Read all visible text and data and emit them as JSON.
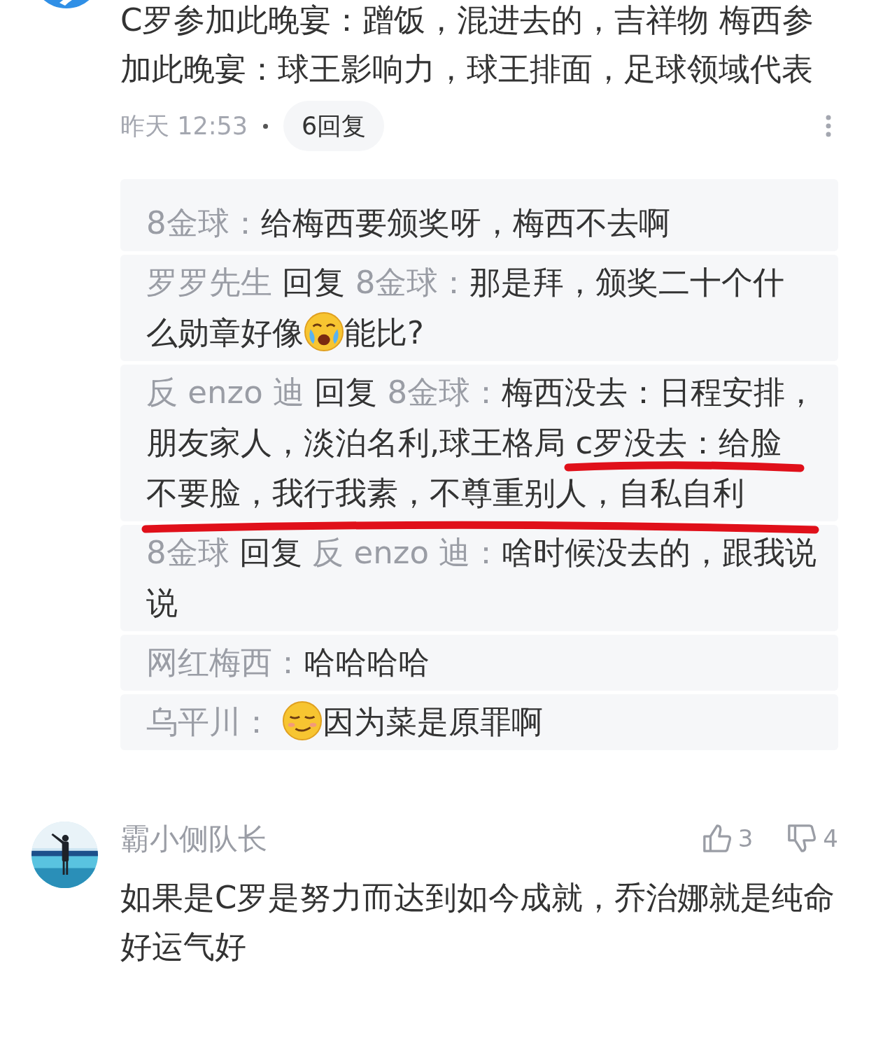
{
  "comments": [
    {
      "avatar": {
        "kind": "picture"
      },
      "text": "C罗参加此晚宴：蹭饭，混进去的，吉祥物 梅西参加此晚宴：球王影响力，球王排面，足球领域代表",
      "time": "昨天 12:53",
      "reply_count": "6回复",
      "replies": [
        {
          "segments": [
            {
              "kind": "author",
              "text": "8金球："
            },
            {
              "kind": "text",
              "text": "给梅西要颁奖呀，梅西不去啊"
            }
          ]
        },
        {
          "segments": [
            {
              "kind": "author",
              "text": "罗罗先生"
            },
            {
              "kind": "text",
              "text": "回复"
            },
            {
              "kind": "author",
              "text": "8金球："
            },
            {
              "kind": "text",
              "text": "那是拜，颁奖二十个什"
            },
            {
              "kind": "text",
              "text": "么勋章好像"
            },
            {
              "kind": "emoji_crying"
            },
            {
              "kind": "text",
              "text": "能比?"
            }
          ]
        },
        {
          "segments": [
            {
              "kind": "author",
              "text": "反 enzo 迪"
            },
            {
              "kind": "text",
              "text": "回复"
            },
            {
              "kind": "author",
              "text": "8金球："
            },
            {
              "kind": "text",
              "text": "梅西没去：日程安排，"
            },
            {
              "kind": "text",
              "text": "朋友家人，淡泊名利,球王格局 c罗没去：给脸"
            },
            {
              "kind": "text",
              "text": "不要脸，我行我素，不尊重别人，自私自利"
            }
          ]
        },
        {
          "segments": [
            {
              "kind": "author",
              "text": "8金球"
            },
            {
              "kind": "text",
              "text": "回复"
            },
            {
              "kind": "author",
              "text": "反 enzo 迪："
            },
            {
              "kind": "text",
              "text": "啥时候没去的，跟我说"
            },
            {
              "kind": "text",
              "text": "说"
            }
          ]
        },
        {
          "segments": [
            {
              "kind": "author",
              "text": "网红梅西："
            },
            {
              "kind": "text",
              "text": "哈哈哈哈"
            }
          ]
        },
        {
          "segments": [
            {
              "kind": "author",
              "text": "乌平川："
            },
            {
              "kind": "emoji_smirk"
            },
            {
              "kind": "text",
              "text": "因为菜是原罪啊"
            }
          ]
        }
      ],
      "annotations": [
        {
          "kind": "underline"
        },
        {
          "kind": "underline"
        }
      ]
    },
    {
      "avatar": {
        "kind": "picture"
      },
      "author": "霸小侧队长",
      "likes": "3",
      "dislikes": "4",
      "text": "如果是C罗是努力而达到如今成就，乔治娜就是纯命好运气好"
    }
  ]
}
